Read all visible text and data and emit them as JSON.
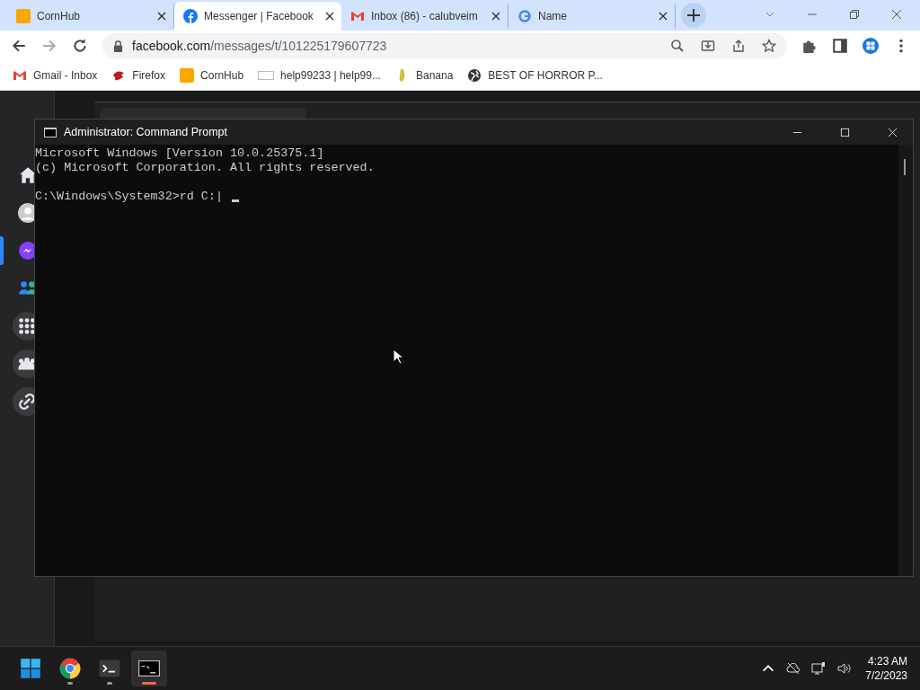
{
  "browser": {
    "tabs": [
      {
        "title": "CornHub",
        "selected": false
      },
      {
        "title": "Messenger | Facebook",
        "selected": true
      },
      {
        "title": "Inbox (86) - calubveim",
        "selected": false
      },
      {
        "title": "Name",
        "selected": false
      }
    ],
    "address": {
      "host": "facebook.com",
      "path": "/messages/t/101225179607723"
    },
    "bookmarks": [
      {
        "label": "Gmail - Inbox"
      },
      {
        "label": "Firefox"
      },
      {
        "label": "CornHub"
      },
      {
        "label": "help99233 | help99..."
      },
      {
        "label": "Banana"
      },
      {
        "label": "BEST OF HORROR P..."
      }
    ]
  },
  "page": {
    "rail": [
      {
        "selected": false
      },
      {
        "selected": false
      },
      {
        "selected": true
      },
      {
        "selected": false
      },
      {
        "selected": false
      },
      {
        "selected": false
      },
      {
        "selected": false
      }
    ]
  },
  "cmd": {
    "title": "Administrator: Command Prompt",
    "lines": [
      "Microsoft Windows [Version 10.0.25375.1]",
      "(c) Microsoft Corporation. All rights reserved."
    ],
    "prompt": "C:\\Windows\\System32>rd C:|"
  },
  "taskbar": {
    "apps": [
      {
        "active": false,
        "running": false
      },
      {
        "active": false,
        "running": true
      },
      {
        "active": false,
        "running": true
      },
      {
        "active": true,
        "running": true
      }
    ],
    "time": "4:23 AM",
    "date": "7/2/2023"
  }
}
